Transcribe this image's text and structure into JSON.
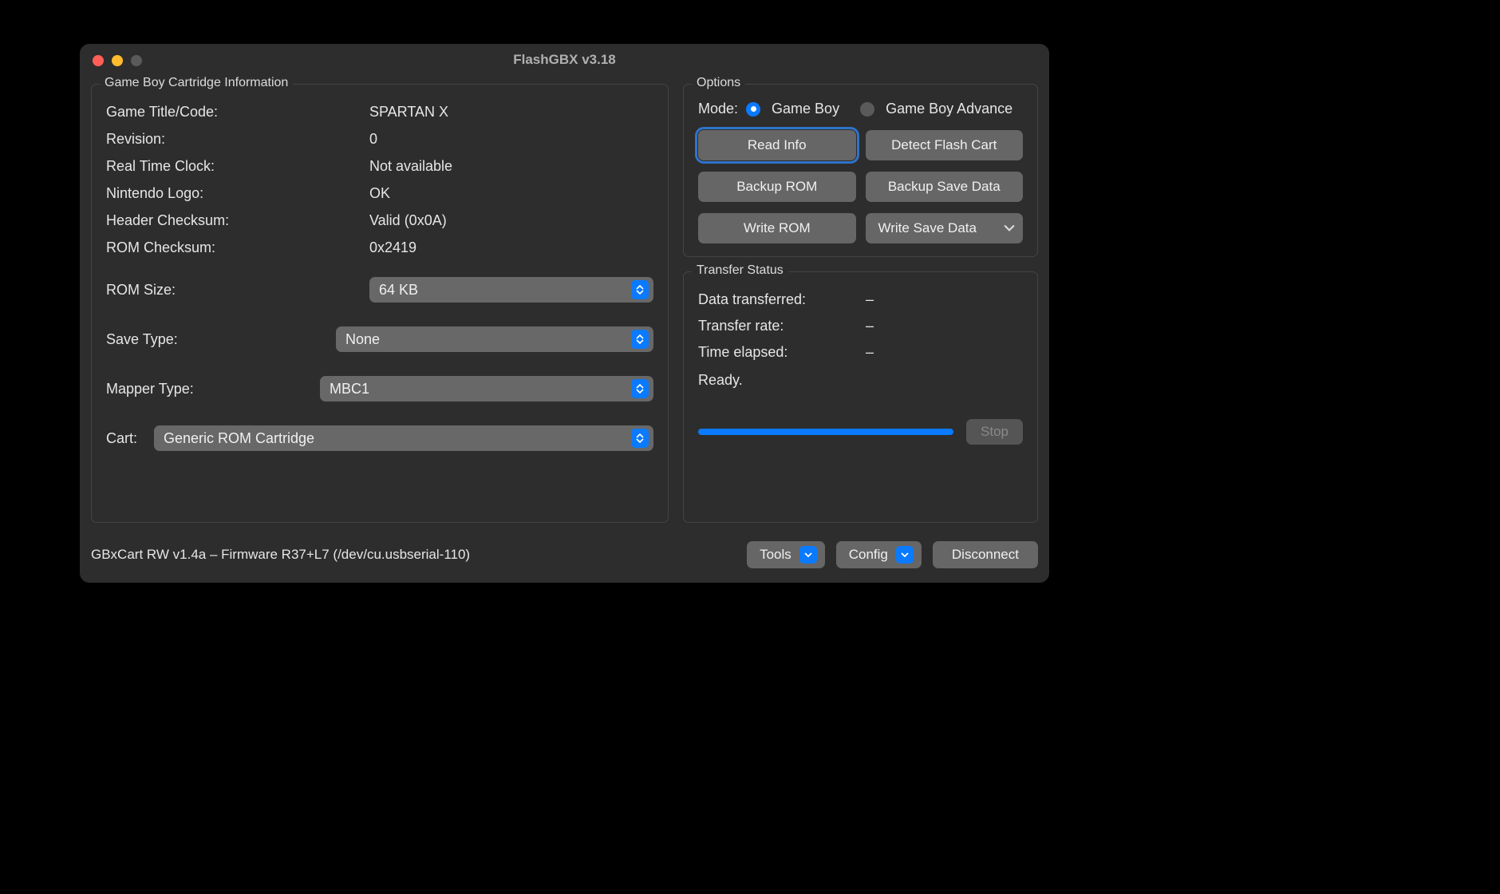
{
  "window": {
    "title": "FlashGBX v3.18"
  },
  "cart_info": {
    "panel_title": "Game Boy Cartridge Information",
    "rows": {
      "game_title_label": "Game Title/Code:",
      "game_title_value": "SPARTAN X",
      "revision_label": "Revision:",
      "revision_value": "0",
      "rtc_label": "Real Time Clock:",
      "rtc_value": "Not available",
      "logo_label": "Nintendo Logo:",
      "logo_value": "OK",
      "header_cksum_label": "Header Checksum:",
      "header_cksum_value": "Valid (0x0A)",
      "rom_cksum_label": "ROM Checksum:",
      "rom_cksum_value": "0x2419"
    },
    "selects": {
      "rom_size_label": "ROM Size:",
      "rom_size_value": "64 KB",
      "save_type_label": "Save Type:",
      "save_type_value": "None",
      "mapper_type_label": "Mapper Type:",
      "mapper_type_value": "MBC1",
      "cart_label": "Cart:",
      "cart_value": "Generic ROM Cartridge"
    }
  },
  "options": {
    "panel_title": "Options",
    "mode_label": "Mode:",
    "mode_gb": "Game Boy",
    "mode_gba": "Game Boy Advance",
    "buttons": {
      "read_info": "Read Info",
      "detect_flash": "Detect Flash Cart",
      "backup_rom": "Backup ROM",
      "backup_save": "Backup Save Data",
      "write_rom": "Write ROM",
      "write_save": "Write Save Data"
    }
  },
  "status": {
    "panel_title": "Transfer Status",
    "data_transferred_label": "Data transferred:",
    "data_transferred_value": "–",
    "transfer_rate_label": "Transfer rate:",
    "transfer_rate_value": "–",
    "time_elapsed_label": "Time elapsed:",
    "time_elapsed_value": "–",
    "ready_text": "Ready.",
    "stop_label": "Stop"
  },
  "footer": {
    "status": "GBxCart RW v1.4a – Firmware R37+L7 (/dev/cu.usbserial-110)",
    "tools": "Tools",
    "config": "Config",
    "disconnect": "Disconnect"
  }
}
